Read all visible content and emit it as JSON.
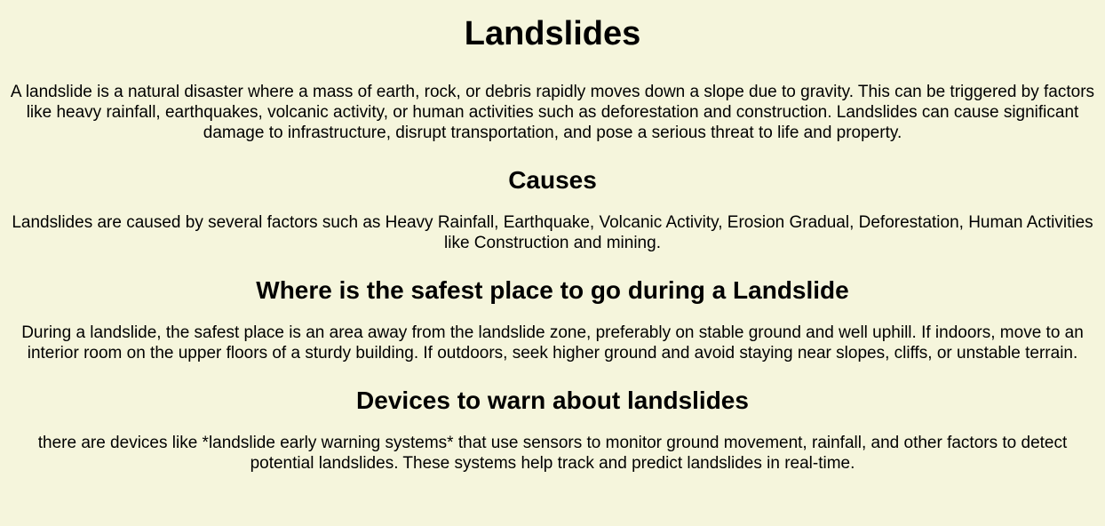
{
  "title": "Landslides",
  "intro": "A landslide is a natural disaster where a mass of earth, rock, or debris rapidly moves down a slope due to gravity. This can be triggered by factors like heavy rainfall, earthquakes, volcanic activity, or human activities such as deforestation and construction. Landslides can cause significant damage to infrastructure, disrupt transportation, and pose a serious threat to life and property.",
  "sections": [
    {
      "heading": "Causes",
      "body": "Landslides are caused by several factors such as Heavy Rainfall, Earthquake, Volcanic Activity, Erosion Gradual, Deforestation, Human Activities like Construction and mining."
    },
    {
      "heading": "Where is the safest place to go during a Landslide",
      "body": "During a landslide, the safest place is an area away from the landslide zone, preferably on stable ground and well uphill. If indoors, move to an interior room on the upper floors of a sturdy building. If outdoors, seek higher ground and avoid staying near slopes, cliffs, or unstable terrain."
    },
    {
      "heading": "Devices to warn about landslides",
      "body": "there are devices like *landslide early warning systems* that use sensors to monitor ground movement, rainfall, and other factors to detect potential landslides. These systems help track and predict landslides in real-time."
    }
  ],
  "colors": {
    "background": "#f5f5dc",
    "text": "#000000"
  }
}
